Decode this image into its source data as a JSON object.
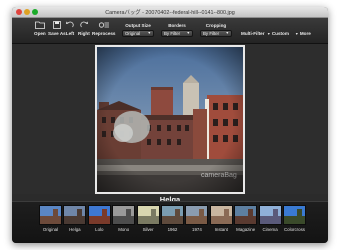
{
  "window": {
    "title": "Cameraバッグ - 20070402--federal-hill--0141--800.jpg"
  },
  "toolbar": {
    "tools": [
      {
        "name": "open",
        "label": "Open",
        "icon": "folder-icon"
      },
      {
        "name": "save-as",
        "label": "Save As",
        "icon": "save-icon"
      },
      {
        "name": "left",
        "label": "Left",
        "icon": "rotate-left-icon"
      },
      {
        "name": "right",
        "label": "Right",
        "icon": "rotate-right-icon"
      },
      {
        "name": "reprocess",
        "label": "Reprocess",
        "icon": "reprocess-icon"
      }
    ],
    "output_size": {
      "label": "Output Size",
      "value": "Original"
    },
    "borders": {
      "label": "Borders",
      "value": "By Filter"
    },
    "cropping": {
      "label": "Cropping",
      "value": "By Filter"
    },
    "multi_filter": "Multi-Filter",
    "custom": "Custom",
    "more": "More"
  },
  "canvas": {
    "watermark": "cameraBag",
    "current_filter": "Helga"
  },
  "filters": [
    {
      "label": "Original",
      "sky": "#5a86c4",
      "ground": "#6d4a3a"
    },
    {
      "label": "Helga",
      "sky": "#6f86a8",
      "ground": "#4a3a33"
    },
    {
      "label": "Lolo",
      "sky": "#3e78d2",
      "ground": "#7a3a2a"
    },
    {
      "label": "Mono",
      "sky": "#9a9a9a",
      "ground": "#4d4d4d"
    },
    {
      "label": "Silver",
      "sky": "#d8d6b0",
      "ground": "#7a7a62"
    },
    {
      "label": "1962",
      "sky": "#7b9cb0",
      "ground": "#5e4a3c"
    },
    {
      "label": "1974",
      "sky": "#8a9cb0",
      "ground": "#7a5a45"
    },
    {
      "label": "Instant",
      "sky": "#c9b6a0",
      "ground": "#8a6a55"
    },
    {
      "label": "Magazine",
      "sky": "#5d7fa0",
      "ground": "#5a3a30"
    },
    {
      "label": "Cinema",
      "sky": "#8fb0d8",
      "ground": "#5a5a7a"
    },
    {
      "label": "Colorcross",
      "sky": "#3a7ad2",
      "ground": "#3a4a2a"
    }
  ]
}
